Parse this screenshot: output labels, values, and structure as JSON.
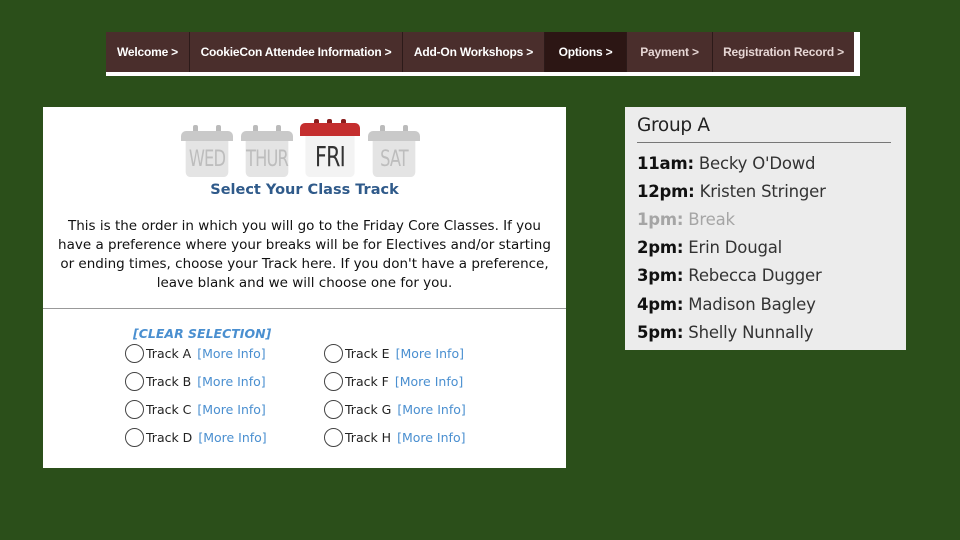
{
  "nav": {
    "items": [
      {
        "label": "Welcome >"
      },
      {
        "label": "CookieCon Attendee Information >"
      },
      {
        "label": "Add-On Workshops >"
      },
      {
        "label": "Options >"
      },
      {
        "label": "Payment >"
      },
      {
        "label": "Registration Record >"
      }
    ],
    "active_index": 3
  },
  "days": [
    {
      "label": "WED",
      "selected": false
    },
    {
      "label": "THUR",
      "selected": false
    },
    {
      "label": "FRI",
      "selected": true
    },
    {
      "label": "SAT",
      "selected": false
    }
  ],
  "track_panel": {
    "title": "Select Your Class Track",
    "description": "This is the order in which you will go to the Friday Core Classes. If you have a preference where your breaks will be for Electives and/or starting or ending times, choose your Track here. If you don't have a preference, leave blank and we will choose one for you.",
    "clear_label": "[CLEAR SELECTION]",
    "more_info_label": "[More Info]",
    "tracks": [
      {
        "label": "Track A"
      },
      {
        "label": "Track B"
      },
      {
        "label": "Track C"
      },
      {
        "label": "Track D"
      },
      {
        "label": "Track E"
      },
      {
        "label": "Track F"
      },
      {
        "label": "Track G"
      },
      {
        "label": "Track H"
      }
    ]
  },
  "group": {
    "title": "Group A",
    "schedule": [
      {
        "time": "11am:",
        "name": "Becky O'Dowd"
      },
      {
        "time": "12pm:",
        "name": "Kristen Stringer"
      },
      {
        "time": "1pm:",
        "name": "Break",
        "muted": true
      },
      {
        "time": "2pm:",
        "name": "Erin Dougal"
      },
      {
        "time": "3pm:",
        "name": "Rebecca Dugger"
      },
      {
        "time": "4pm:",
        "name": "Madison Bagley"
      },
      {
        "time": "5pm:",
        "name": "Shelly Nunnally"
      }
    ]
  },
  "colors": {
    "background": "#2b4f1a",
    "nav_bg": "#4a2e2c",
    "nav_active": "#2c1614",
    "title_blue": "#2f5a8a",
    "link_blue": "#4a8fd0",
    "fri_red": "#c42e2e"
  }
}
